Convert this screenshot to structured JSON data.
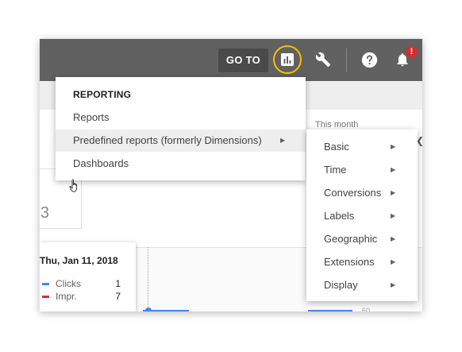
{
  "toolbar": {
    "goto_label": "GO TO",
    "alert_badge": "!",
    "icons": [
      "bar-chart-icon",
      "wrench-icon",
      "help-icon",
      "bell-icon"
    ],
    "accent_color": "#f7c000"
  },
  "header": {
    "period_label": "This month"
  },
  "stat_card": {
    "value": "3"
  },
  "tooltip": {
    "date": "Thu, Jan 11, 2018",
    "rows": [
      {
        "label": "Clicks",
        "value": "1",
        "color": "#4285f4"
      },
      {
        "label": "Impr.",
        "value": "7",
        "color": "#d32f2f"
      }
    ]
  },
  "chart": {
    "axis_tick": "60"
  },
  "menu": {
    "heading": "REPORTING",
    "items": [
      {
        "label": "Reports"
      },
      {
        "label": "Predefined reports (formerly Dimensions)"
      },
      {
        "label": "Dashboards"
      }
    ]
  },
  "submenu": {
    "items": [
      {
        "label": "Basic"
      },
      {
        "label": "Time"
      },
      {
        "label": "Conversions"
      },
      {
        "label": "Labels"
      },
      {
        "label": "Geographic"
      },
      {
        "label": "Extensions"
      },
      {
        "label": "Display"
      }
    ]
  }
}
